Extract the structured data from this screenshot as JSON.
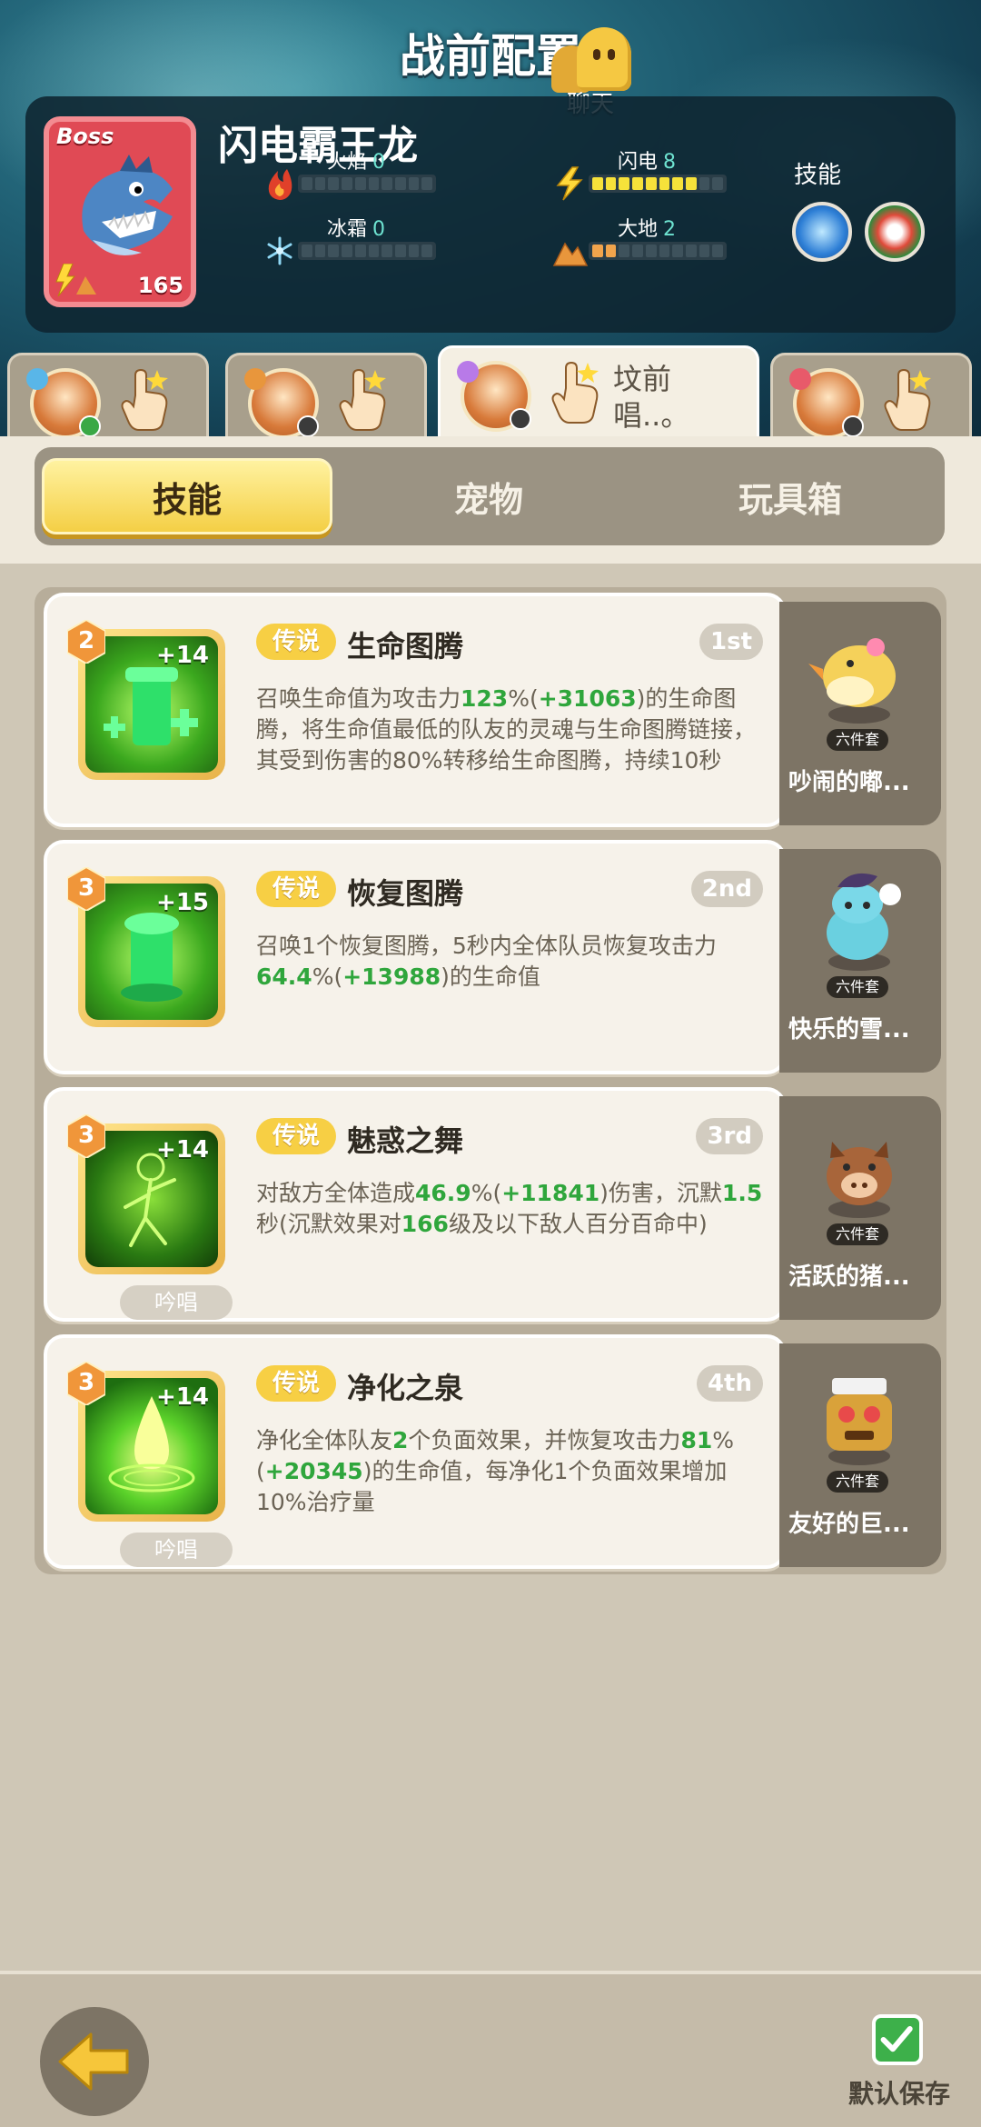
{
  "header": {
    "title": "战前配置",
    "chat_label": "聊天"
  },
  "boss": {
    "badge": "Boss",
    "name": "闪电霸王龙",
    "level": "165",
    "stats": [
      {
        "label": "火焰",
        "value": "0",
        "icon": "fire-icon",
        "bars": 0
      },
      {
        "label": "闪电",
        "value": "8",
        "icon": "lightning-icon",
        "bars": 8
      },
      {
        "label": "冰霜",
        "value": "0",
        "icon": "frost-icon",
        "bars": 0
      },
      {
        "label": "大地",
        "value": "2",
        "icon": "earth-icon",
        "bars": 2
      }
    ],
    "skills_label": "技能"
  },
  "hero_tabs": [
    {
      "text": "",
      "active": false
    },
    {
      "text": "",
      "active": false
    },
    {
      "text": "坟前唱..。",
      "active": true
    },
    {
      "text": "",
      "active": false
    }
  ],
  "main_tabs": [
    {
      "label": "技能",
      "active": true
    },
    {
      "label": "宠物",
      "active": false
    },
    {
      "label": "玩具箱",
      "active": false
    }
  ],
  "skills": [
    {
      "level": "2",
      "plus": "+14",
      "rarity": "传说",
      "name": "生命图腾",
      "order": "1st",
      "chant": "",
      "desc": [
        {
          "t": "召唤生命值为攻击力"
        },
        {
          "t": "123",
          "g": true
        },
        {
          "t": "%("
        },
        {
          "t": "+31063",
          "g": true
        },
        {
          "t": ")的生命图腾，将生命值最低的队友的灵魂与生命图腾链接，其受到伤害的80%转移给生命图腾，持续10秒"
        }
      ],
      "pet": {
        "name": "吵闹的嘟...",
        "set": "六件套"
      }
    },
    {
      "level": "3",
      "plus": "+15",
      "rarity": "传说",
      "name": "恢复图腾",
      "order": "2nd",
      "chant": "",
      "desc": [
        {
          "t": "召唤1个恢复图腾，5秒内全体队员恢复攻击力"
        },
        {
          "t": "64.4",
          "g": true
        },
        {
          "t": "%("
        },
        {
          "t": "+13988",
          "g": true
        },
        {
          "t": ")的生命值"
        }
      ],
      "pet": {
        "name": "快乐的雪...",
        "set": "六件套"
      }
    },
    {
      "level": "3",
      "plus": "+14",
      "rarity": "传说",
      "name": "魅惑之舞",
      "order": "3rd",
      "chant": "吟唱",
      "desc": [
        {
          "t": "对敌方全体造成"
        },
        {
          "t": "46.9",
          "g": true
        },
        {
          "t": "%("
        },
        {
          "t": "+11841",
          "g": true
        },
        {
          "t": ")伤害，沉默"
        },
        {
          "t": "1.5",
          "g": true
        },
        {
          "t": "秒(沉默效果对"
        },
        {
          "t": "166",
          "g": true
        },
        {
          "t": "级及以下敌人百分百命中)"
        }
      ],
      "pet": {
        "name": "活跃的猪...",
        "set": "六件套"
      }
    },
    {
      "level": "3",
      "plus": "+14",
      "rarity": "传说",
      "name": "净化之泉",
      "order": "4th",
      "chant": "吟唱",
      "desc": [
        {
          "t": "净化全体队友"
        },
        {
          "t": "2",
          "g": true
        },
        {
          "t": "个负面效果，并恢复攻击力"
        },
        {
          "t": "81",
          "g": true
        },
        {
          "t": "%("
        },
        {
          "t": "+20345",
          "g": true
        },
        {
          "t": ")的生命值，每净化1个负面效果增加10%治疗量"
        }
      ],
      "pet": {
        "name": "友好的巨...",
        "set": "六件套"
      }
    }
  ],
  "footer": {
    "save_label": "默认保存"
  }
}
